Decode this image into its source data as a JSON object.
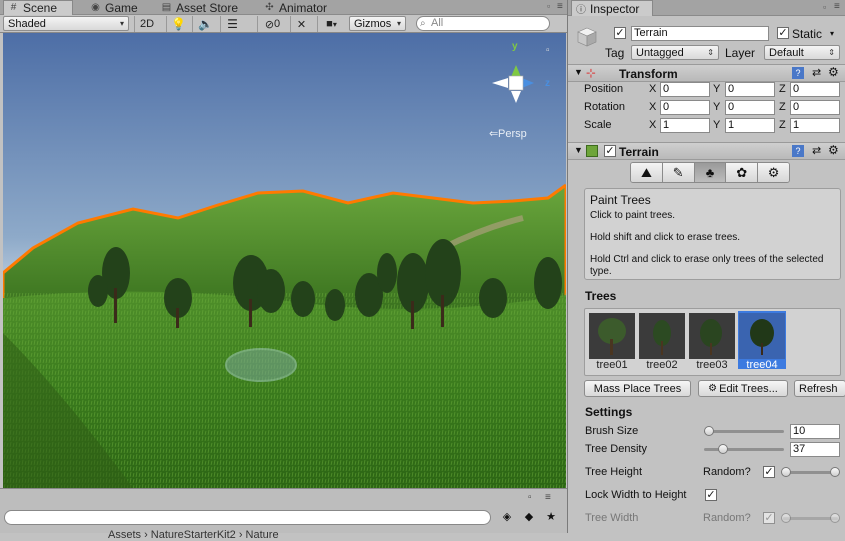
{
  "scene_tabs": [
    {
      "icon": "hash-icon",
      "label": "Scene"
    },
    {
      "icon": "game-controller-icon",
      "label": "Game"
    },
    {
      "icon": "store-icon",
      "label": "Asset Store"
    },
    {
      "icon": "animator-icon",
      "label": "Animator"
    }
  ],
  "scene_toolbar": {
    "draw_mode": "Shaded",
    "mode_2d": "2D",
    "hidden_count": "0",
    "gizmos_label": "Gizmos",
    "search_placeholder": "All"
  },
  "gizmo": {
    "y_label": "y",
    "x_label": "x",
    "z_label": "z",
    "persp_label": "Persp"
  },
  "project_bar": {
    "breadcrumb": "Assets › NatureStarterKit2 › Nature"
  },
  "inspector": {
    "tab_label": "Inspector",
    "object": {
      "name": "Terrain",
      "active": true,
      "static_label": "Static",
      "static": true,
      "tag_label": "Tag",
      "tag_value": "Untagged",
      "layer_label": "Layer",
      "layer_value": "Default"
    },
    "transform": {
      "title": "Transform",
      "rows": [
        {
          "label": "Position",
          "x": "0",
          "y": "0",
          "z": "0"
        },
        {
          "label": "Rotation",
          "x": "0",
          "y": "0",
          "z": "0"
        },
        {
          "label": "Scale",
          "x": "1",
          "y": "1",
          "z": "1"
        }
      ],
      "axis_x": "X",
      "axis_y": "Y",
      "axis_z": "Z"
    },
    "terrain": {
      "title": "Terrain",
      "tools": [
        "raise-terrain-icon",
        "paint-texture-icon",
        "paint-trees-icon",
        "paint-details-icon",
        "terrain-settings-icon"
      ],
      "selected_tool": 2,
      "help_title": "Paint Trees",
      "help_line1": "Click to paint trees.",
      "help_line2": "Hold shift and click to erase trees.",
      "help_line3": "Hold Ctrl and click to erase only trees of the selected type.",
      "trees_heading": "Trees",
      "trees": [
        "tree01",
        "tree02",
        "tree03",
        "tree04"
      ],
      "selected_tree": 3,
      "mass_place_label": "Mass Place Trees",
      "edit_trees_label": "Edit Trees...",
      "refresh_label": "Refresh",
      "settings_heading": "Settings",
      "brush_size_label": "Brush Size",
      "brush_size": "10",
      "brush_size_fraction": 0.0,
      "tree_density_label": "Tree Density",
      "tree_density": "37",
      "tree_density_fraction": 0.2,
      "tree_height_label": "Tree Height",
      "random_label": "Random?",
      "tree_height_random": true,
      "lock_width_label": "Lock Width to Height",
      "lock_width": true,
      "tree_width_label": "Tree Width",
      "tree_width_random": true
    }
  },
  "colors": {
    "accent": "#3d7be0",
    "terrain_outline": "#ff7a00",
    "sky_top": "#4f6fa5",
    "sky_horizon": "#d8e2ea",
    "grass": "#3d7d1f"
  }
}
